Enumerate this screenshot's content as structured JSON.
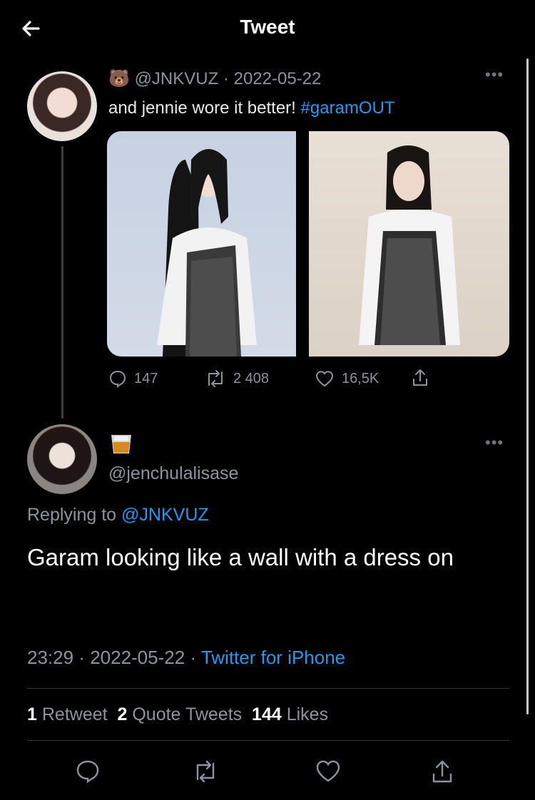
{
  "header": {
    "title": "Tweet",
    "back_icon": "arrow-left-icon"
  },
  "quoted_tweet": {
    "handle": "@JNKVUZ",
    "date": "2022-05-22",
    "text_plain": "and jennie wore it better! ",
    "hashtag": "#garamOUT",
    "counts": {
      "replies": "147",
      "retweets": "2 408",
      "likes": "16,5K"
    }
  },
  "reply_tweet": {
    "handle": "@jenchulalisase",
    "replying_label": "Replying to ",
    "replying_handle": "@JNKVUZ",
    "body": "Garam looking like a wall with a dress on",
    "time": "23:29",
    "date": "2022-05-22",
    "source": "Twitter for iPhone",
    "stats": {
      "retweets_count": "1",
      "retweets_label": "Retweet",
      "quotes_count": "2",
      "quotes_label": "Quote Tweets",
      "likes_count": "144",
      "likes_label": "Likes"
    }
  },
  "colors": {
    "accent": "#1d9bf0",
    "muted": "#8b949e",
    "background": "#000000"
  }
}
